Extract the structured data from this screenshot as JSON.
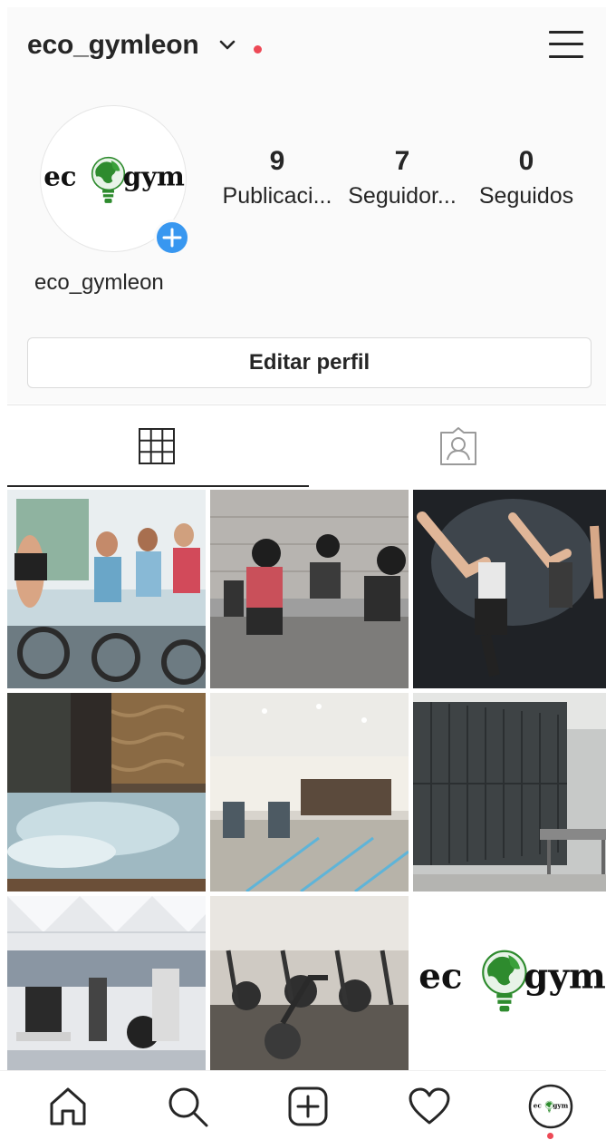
{
  "profile": {
    "username": "eco_gymleon",
    "display_name": "eco_gymleon",
    "logo_text_left": "ec",
    "logo_text_right": "gym"
  },
  "stats": [
    {
      "value": "9",
      "label": "Publicaci..."
    },
    {
      "value": "7",
      "label": "Seguidor..."
    },
    {
      "value": "0",
      "label": "Seguidos"
    }
  ],
  "actions": {
    "edit_profile_label": "Editar perfil"
  },
  "tabs": [
    {
      "name": "grid",
      "icon": "grid-icon",
      "active": true
    },
    {
      "name": "tagged",
      "icon": "tagged-person-icon",
      "active": false
    }
  ],
  "posts": [
    {
      "subject": "spinning class"
    },
    {
      "subject": "barbell squats"
    },
    {
      "subject": "martial arts kick"
    },
    {
      "subject": "spa pool"
    },
    {
      "subject": "gym reception"
    },
    {
      "subject": "locker room"
    },
    {
      "subject": "weight machines"
    },
    {
      "subject": "cardio bikes"
    },
    {
      "subject": "eco gym logo"
    }
  ],
  "bottom_nav": [
    {
      "icon": "home-icon"
    },
    {
      "icon": "search-icon"
    },
    {
      "icon": "new-post-icon"
    },
    {
      "icon": "activity-heart-icon"
    },
    {
      "icon": "profile-avatar-icon"
    }
  ],
  "colors": {
    "accent_blue": "#3897f0",
    "notification_red": "#ed4956",
    "text": "#262626",
    "logo_green": "#2e8b2e"
  }
}
